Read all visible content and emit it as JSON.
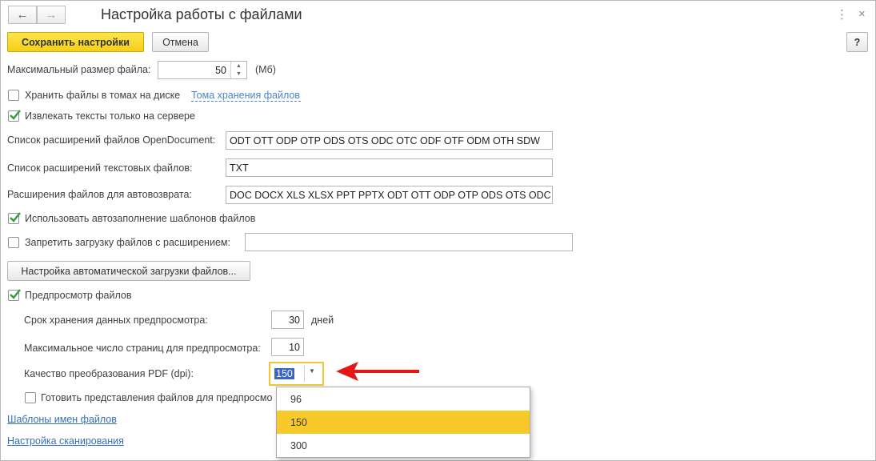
{
  "window": {
    "title": "Настройка работы с файлами",
    "more_icon": "⋮",
    "close_icon": "×",
    "back_icon": "←",
    "forward_icon": "→"
  },
  "toolbar": {
    "save_label": "Сохранить настройки",
    "cancel_label": "Отмена",
    "help_label": "?"
  },
  "form": {
    "max_size_label": "Максимальный размер файла:",
    "max_size_value": "50",
    "max_size_unit": "(Мб)",
    "store_in_volumes_label": "Хранить файлы в томах на диске",
    "store_in_volumes_checked": false,
    "volumes_link": "Тома хранения файлов",
    "extract_texts_label": "Извлекать тексты только на сервере",
    "extract_texts_checked": true,
    "opendoc_label": "Список расширений файлов OpenDocument:",
    "opendoc_value": "ODT OTT ODP OTP ODS OTS ODC OTC ODF OTF ODM OTH SDW",
    "text_ext_label": "Список расширений текстовых файлов:",
    "text_ext_value": "TXT",
    "autoreturn_label": "Расширения файлов для автовозврата:",
    "autoreturn_value": "DOC DOCX XLS XLSX PPT PPTX ODT OTT ODP OTP ODS OTS ODC",
    "autofill_label": "Использовать автозаполнение шаблонов файлов",
    "autofill_checked": true,
    "forbid_label": "Запретить загрузку файлов с расширением:",
    "forbid_checked": false,
    "forbid_value": "",
    "autoload_button": "Настройка автоматической загрузки файлов...",
    "preview_label": "Предпросмотр файлов",
    "preview_checked": true,
    "retention_label": "Срок хранения данных предпросмотра:",
    "retention_value": "30",
    "retention_unit": "дней",
    "max_pages_label": "Максимальное число страниц для предпросмотра:",
    "max_pages_value": "10",
    "pdf_quality_label": "Качество преобразования PDF (dpi):",
    "pdf_quality_value": "150",
    "prepare_label": "Готовить представления файлов для предпросмо",
    "prepare_checked": false,
    "templates_link": "Шаблоны имен файлов",
    "scan_link": "Настройка сканирования"
  },
  "dropdown": {
    "options": [
      "96",
      "150",
      "300"
    ],
    "selected": "150"
  },
  "colors": {
    "accent_yellow": "#f8c92b",
    "highlight_border": "#f3c435",
    "link": "#3670b8",
    "check": "#3a9a3a",
    "arrow": "#e81515"
  }
}
